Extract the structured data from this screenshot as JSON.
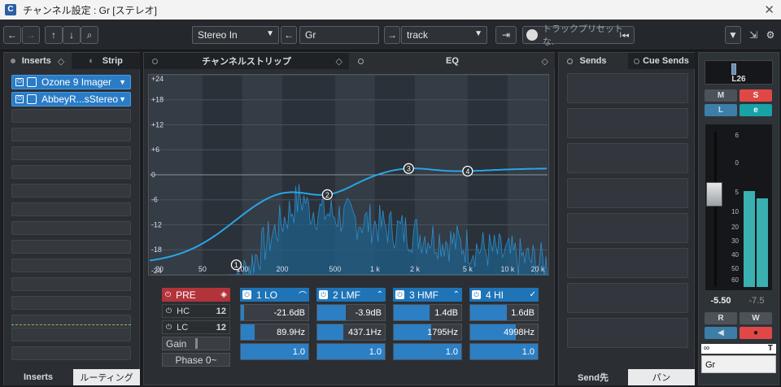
{
  "title": "チャンネル設定 : Gr [ステレオ]",
  "toolbar": {
    "input": "Stereo In",
    "name": "Gr",
    "output": "track",
    "preset_placeholder": "トラックプリセットな."
  },
  "inserts": {
    "tab_inserts": "Inserts",
    "tab_strip": "Strip",
    "plugins": [
      "Ozone 9 Imager",
      "AbbeyR...sStereo"
    ],
    "bottom_tab_inserts": "Inserts",
    "bottom_tab_routing": "ルーティング"
  },
  "center": {
    "tab_strip": "チャンネルストリップ",
    "tab_eq": "EQ",
    "eq_name": "Gr"
  },
  "eq": {
    "y_ticks": [
      "+24",
      "+18",
      "+12",
      "+6",
      "0",
      "-6",
      "-12",
      "-18",
      "-24"
    ],
    "x_ticks": [
      "20",
      "50",
      "100",
      "200",
      "500",
      "1 k",
      "2 k",
      "5 k",
      "10 k",
      "20 k"
    ],
    "nodes": [
      "1",
      "2",
      "3",
      "4"
    ]
  },
  "pre": {
    "pre_label": "PRE",
    "hc_label": "HC",
    "lc_label": "LC",
    "gain_label": "Gain",
    "phase_label": "Phase 0~"
  },
  "bands": [
    {
      "name": "1 LO",
      "gain": "-21.6dB",
      "freq": "89.9Hz",
      "q": "1.0",
      "gain_frac": 0.05,
      "freq_frac": 0.2,
      "q_frac": 1.0
    },
    {
      "name": "2 LMF",
      "gain": "-3.9dB",
      "freq": "437.1Hz",
      "q": "1.0",
      "gain_frac": 0.42,
      "freq_frac": 0.38,
      "q_frac": 1.0
    },
    {
      "name": "3 HMF",
      "gain": "1.4dB",
      "freq": "1795Hz",
      "q": "1.0",
      "gain_frac": 0.53,
      "freq_frac": 0.55,
      "q_frac": 1.0
    },
    {
      "name": "4 HI",
      "gain": "1.6dB",
      "freq": "4998Hz",
      "q": "1.0",
      "gain_frac": 0.54,
      "freq_frac": 0.67,
      "q_frac": 1.0
    }
  ],
  "sends": {
    "tab_sends": "Sends",
    "tab_cue": "Cue Sends",
    "bottom_send": "Send先",
    "bottom_pan": "パン"
  },
  "fader": {
    "pan": "L26",
    "m": "M",
    "s": "S",
    "l": "L",
    "e": "e",
    "scale": [
      "6",
      "0",
      "5",
      "10",
      "20",
      "30",
      "40",
      "50",
      "60",
      "00"
    ],
    "level": "-5.50",
    "peak": "-7.5",
    "r": "R",
    "w": "W",
    "name": "Gr",
    "link": "T"
  }
}
